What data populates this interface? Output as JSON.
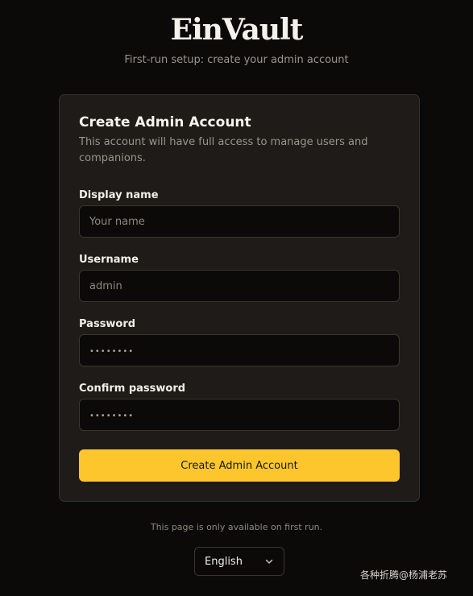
{
  "brand": {
    "name": "EinVault"
  },
  "subtitle": "First-run setup: create your admin account",
  "card": {
    "title": "Create Admin Account",
    "description": "This account will have full access to manage users and companions."
  },
  "form": {
    "display_name": {
      "label": "Display name",
      "placeholder": "Your name"
    },
    "username": {
      "label": "Username",
      "placeholder": "admin"
    },
    "password": {
      "label": "Password",
      "placeholder": "••••••••"
    },
    "confirm_password": {
      "label": "Confirm password",
      "placeholder": "••••••••"
    },
    "submit_label": "Create Admin Account"
  },
  "footnote": "This page is only available on first run.",
  "language": {
    "selected": "English"
  },
  "watermark": "各种折腾@杨浦老苏",
  "colors": {
    "accent": "#fcc62c",
    "background": "#0b0a09",
    "card": "#1e1b18"
  }
}
